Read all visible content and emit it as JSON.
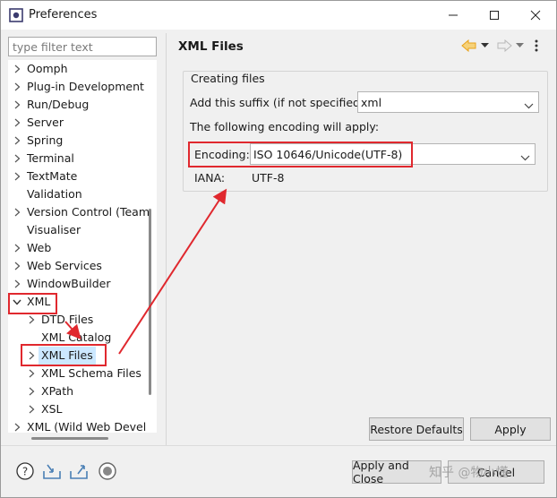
{
  "window": {
    "title": "Preferences"
  },
  "filter": {
    "placeholder": "type filter text"
  },
  "tree": {
    "items": [
      {
        "label": "Oomph",
        "expander": "collapsed"
      },
      {
        "label": "Plug-in Development",
        "expander": "collapsed"
      },
      {
        "label": "Run/Debug",
        "expander": "collapsed"
      },
      {
        "label": "Server",
        "expander": "collapsed"
      },
      {
        "label": "Spring",
        "expander": "collapsed"
      },
      {
        "label": "Terminal",
        "expander": "collapsed"
      },
      {
        "label": "TextMate",
        "expander": "collapsed"
      },
      {
        "label": "Validation",
        "expander": "none"
      },
      {
        "label": "Version Control (Team",
        "expander": "collapsed"
      },
      {
        "label": "Visualiser",
        "expander": "none"
      },
      {
        "label": "Web",
        "expander": "collapsed"
      },
      {
        "label": "Web Services",
        "expander": "collapsed"
      },
      {
        "label": "WindowBuilder",
        "expander": "collapsed"
      },
      {
        "label": "XML",
        "expander": "expanded"
      },
      {
        "label": "DTD Files",
        "expander": "collapsed"
      },
      {
        "label": "XML Catalog",
        "expander": "none"
      },
      {
        "label": "XML Files",
        "expander": "collapsed",
        "selected": true
      },
      {
        "label": "XML Schema Files",
        "expander": "collapsed"
      },
      {
        "label": "XPath",
        "expander": "collapsed"
      },
      {
        "label": "XSL",
        "expander": "collapsed"
      },
      {
        "label": "XML (Wild Web Devel",
        "expander": "collapsed"
      }
    ]
  },
  "page": {
    "title": "XML Files",
    "group_title": "Creating files",
    "suffix_label": "Add this suffix (if not specified):",
    "suffix_value": "xml",
    "encoding_note": "The following encoding will apply:",
    "encoding_label": "Encoding:",
    "encoding_value": "ISO 10646/Unicode(UTF-8)",
    "iana_label": "IANA:",
    "iana_value": "UTF-8"
  },
  "buttons": {
    "restore_defaults": "Restore Defaults",
    "apply": "Apply",
    "apply_and_close": "Apply and Close",
    "cancel": "Cancel"
  },
  "watermark": "知乎 @物小懂",
  "colors": {
    "annotation": "#e0282e",
    "selection": "#cce8ff",
    "back_arrow": "#e8a21a"
  },
  "icons": [
    "eclipse-icon",
    "minimize-icon",
    "maximize-icon",
    "close-icon",
    "back-icon",
    "forward-icon",
    "more-icon",
    "help-icon",
    "import-icon",
    "export-icon",
    "record-icon"
  ]
}
